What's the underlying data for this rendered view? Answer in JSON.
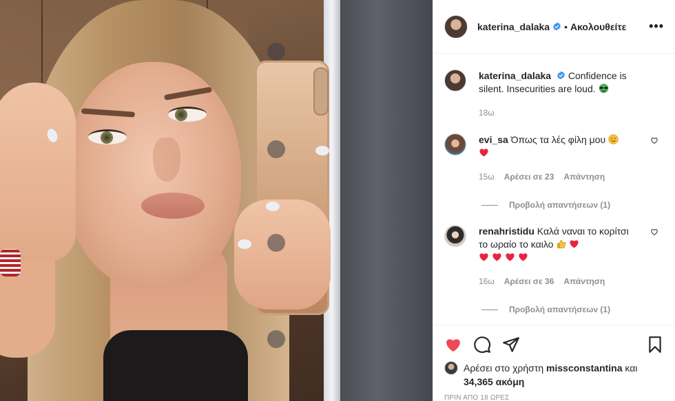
{
  "post": {
    "author": "katerina_dalaka",
    "follow_separator": "•",
    "follow_status": "Ακολουθείτε",
    "more_label": "•••"
  },
  "caption": {
    "username": "katerina_dalaka",
    "text": "Confidence is silent. Insecurities are loud. ",
    "age": "18ω"
  },
  "comments": [
    {
      "username": "evi_sa",
      "text": "Όπως τα λές φίλη μου",
      "age": "15ω",
      "likes": "Αρέσει σε 23",
      "reply": "Απάντηση",
      "view_replies": "Προβολή απαντήσεων (1)"
    },
    {
      "username": "renahristidu",
      "text": "Καλά ναναι το κορίτσι το ωραίο το καιλο",
      "age": "16ω",
      "likes": "Αρέσει σε 36",
      "reply": "Απάντηση",
      "view_replies": "Προβολή απαντήσεων (1)"
    }
  ],
  "engagement": {
    "liked_prefix": "Αρέσει στο χρήστη",
    "liked_user": "missconstantina",
    "liked_mid": "και",
    "liked_count": "34,365 ακόμη",
    "timestamp": "ΠΡΙΝ ΑΠΟ 18 ΩΡΕΣ"
  },
  "colors": {
    "like_red": "#ed4956",
    "verified_blue": "#3897f0",
    "muted": "#8e8e8e"
  },
  "icons": [
    "verified-badge-icon",
    "more-options-icon",
    "heart-icon",
    "comment-icon",
    "share-icon",
    "bookmark-icon",
    "red-heart-emoji",
    "sunglasses-emoji",
    "smile-emoji",
    "thumbs-up-emoji"
  ]
}
